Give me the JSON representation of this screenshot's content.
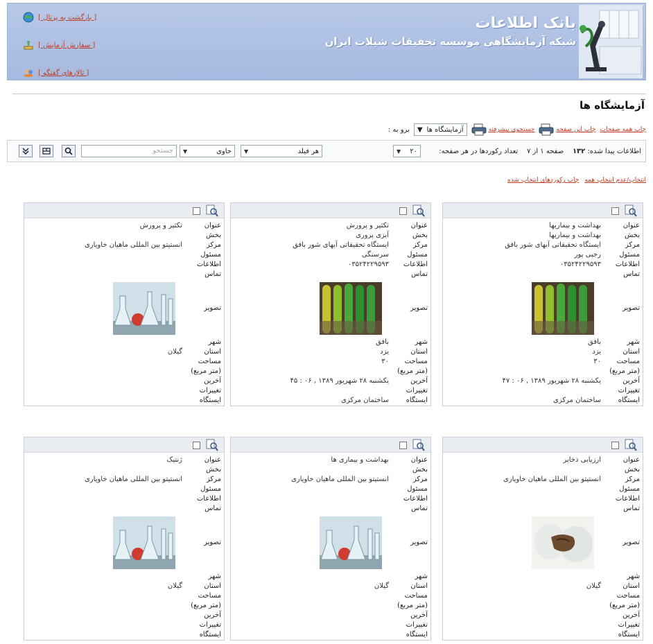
{
  "header": {
    "title_line1": "بانک اطلاعات",
    "title_line2": "شبکه آزمایشگاهی موسسه تحقیقات شیلات ایران",
    "links": [
      {
        "label": "[ بازگشت به پرتال ]",
        "icon": "globe-icon"
      },
      {
        "label": "[ سفارش آزمایش ]",
        "icon": "lab-order-icon"
      },
      {
        "label": "[ تالارهای گفتگو ]",
        "icon": "forum-icon"
      }
    ]
  },
  "page_title": "آزمایشگاه ها",
  "goto": {
    "label": "برو به :",
    "selected": "آزمایشگاه ها",
    "advanced_search": "جستجوی پیشرفته",
    "print_page": "چاپ این صفحه",
    "print_all": "چاپ همه صفحات"
  },
  "toolbar": {
    "found_label": "اطلاعات پیدا شده:",
    "found_count": "۱۳۲",
    "page_text": "صفحه ۱ از ۷",
    "per_page_label": "تعداد رکوردها در هر صفحه:",
    "per_page_value": "۲۰",
    "field_select": "هر فیلد",
    "op_select": "حاوی",
    "search_placeholder": "جستجو"
  },
  "selection": {
    "select_all": "انتخاب/عدم انتخاب همه",
    "print_selected": "چاپ رکوردهای انتخاب شده"
  },
  "field_labels": {
    "title": "عنوان",
    "section": "بخش",
    "center": "مرکز",
    "responsible": "مسئول",
    "contact": "اطلاعات تماس",
    "image": "تصویر",
    "city": "شهر",
    "province": "استان",
    "area": "مساحت (متر مربع)",
    "modified": "آخرین تغییرات",
    "station": "ایستگاه"
  },
  "cards": [
    {
      "title": "بهداشت و بیماریها",
      "section": "بهداشت و بیماریها",
      "center": "ایستگاه تحقیقاتی آبهای شور بافق",
      "responsible": "رجبی پور",
      "contact": "۰۳۵۲۴۲۲۹۵۹۳",
      "image": "green-tubes",
      "city": "بافق",
      "province": "یزد",
      "area": "۳۰",
      "modified": "یکشنبه ۲۸ شهریور ۱۳۸۹ , ۰۶ : ۴۷",
      "station": "ساختمان مرکزی"
    },
    {
      "title": "تکثیر و پرورش",
      "section": "آبزی پروری",
      "center": "ایستگاه تحقیقاتی آبهای شور بافق",
      "responsible": "سرسنگی",
      "contact": "۰۳۵۲۴۲۲۹۵۹۳",
      "image": "green-tubes",
      "city": "بافق",
      "province": "یزد",
      "area": "۳۰",
      "modified": "یکشنبه ۲۸ شهریور ۱۳۸۹ , ۰۶ : ۴۵",
      "station": "ساختمان مرکزی"
    },
    {
      "title": "تکثیر و پرورش",
      "section": "",
      "center": "انستیتو بین المللی ماهیان خاویاری",
      "responsible": "",
      "contact": "",
      "image": "flasks",
      "city": "",
      "province": "گیلان",
      "area": "",
      "modified": "",
      "station": ""
    },
    {
      "title": "ارزیابی ذخایر",
      "section": "",
      "center": "انستیتو بین المللی ماهیان خاویاری",
      "responsible": "",
      "contact": "",
      "image": "gloved-hands",
      "city": "",
      "province": "گیلان",
      "area": "",
      "modified": "",
      "station": ""
    },
    {
      "title": "بهداشت و بیماری ها",
      "section": "",
      "center": "انستیتو بین المللی ماهیان خاویاری",
      "responsible": "",
      "contact": "",
      "image": "flasks",
      "city": "",
      "province": "گیلان",
      "area": "",
      "modified": "",
      "station": ""
    },
    {
      "title": "ژنتیک",
      "section": "",
      "center": "انستیتو بین المللی ماهیان خاویاری",
      "responsible": "",
      "contact": "",
      "image": "flasks",
      "city": "",
      "province": "گیلان",
      "area": "",
      "modified": "",
      "station": ""
    }
  ]
}
